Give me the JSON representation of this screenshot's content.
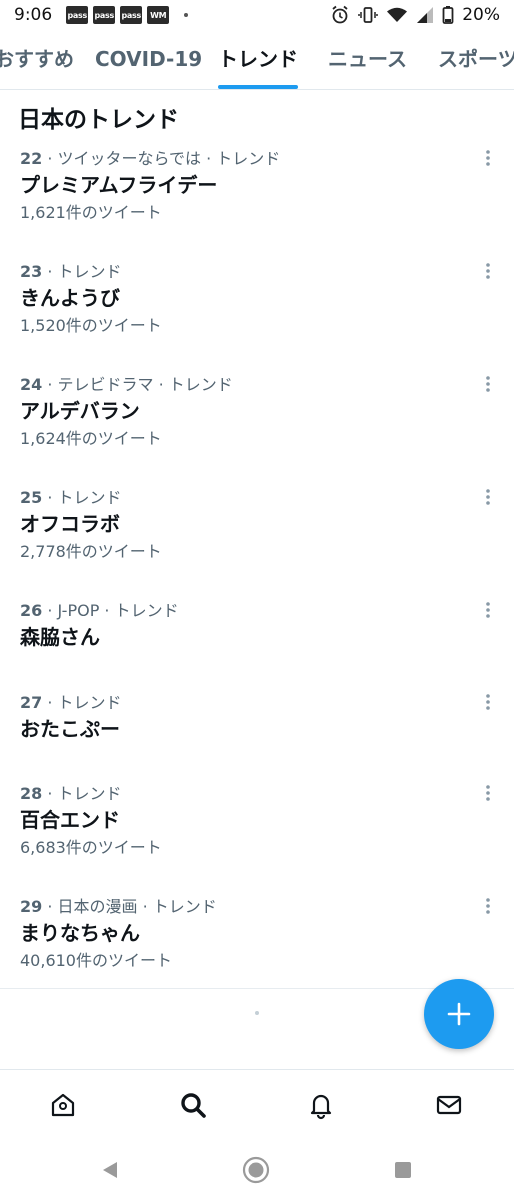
{
  "status_bar": {
    "time": "9:06",
    "notifications": [
      "pass",
      "pass",
      "pass",
      "WM"
    ],
    "battery": "20%"
  },
  "tabs": [
    {
      "label": "おすすめ",
      "active": false
    },
    {
      "label": "COVID-19",
      "active": false
    },
    {
      "label": "トレンド",
      "active": true
    },
    {
      "label": "ニュース",
      "active": false
    },
    {
      "label": "スポーツ",
      "active": false
    }
  ],
  "section_title": "日本のトレンド",
  "trends": [
    {
      "rank": "22",
      "context": "ツイッターならでは · トレンド",
      "name": "プレミアムフライデー",
      "tweets": "1,621件のツイート"
    },
    {
      "rank": "23",
      "context": "トレンド",
      "name": "きんようび",
      "tweets": "1,520件のツイート"
    },
    {
      "rank": "24",
      "context": "テレビドラマ · トレンド",
      "name": "アルデバラン",
      "tweets": "1,624件のツイート"
    },
    {
      "rank": "25",
      "context": "トレンド",
      "name": "オフコラボ",
      "tweets": "2,778件のツイート"
    },
    {
      "rank": "26",
      "context": "J-POP · トレンド",
      "name": "森脇さん",
      "tweets": ""
    },
    {
      "rank": "27",
      "context": "トレンド",
      "name": "おたこぷー",
      "tweets": ""
    },
    {
      "rank": "28",
      "context": "トレンド",
      "name": "百合エンド",
      "tweets": "6,683件のツイート"
    },
    {
      "rank": "29",
      "context": "日本の漫画 · トレンド",
      "name": "まりなちゃん",
      "tweets": "40,610件のツイート"
    }
  ],
  "bottom_nav": [
    "home-icon",
    "search-icon",
    "notifications-icon",
    "messages-icon"
  ],
  "colors": {
    "accent": "#1d9bf0",
    "text": "#0f1419",
    "secondary": "#536471"
  }
}
